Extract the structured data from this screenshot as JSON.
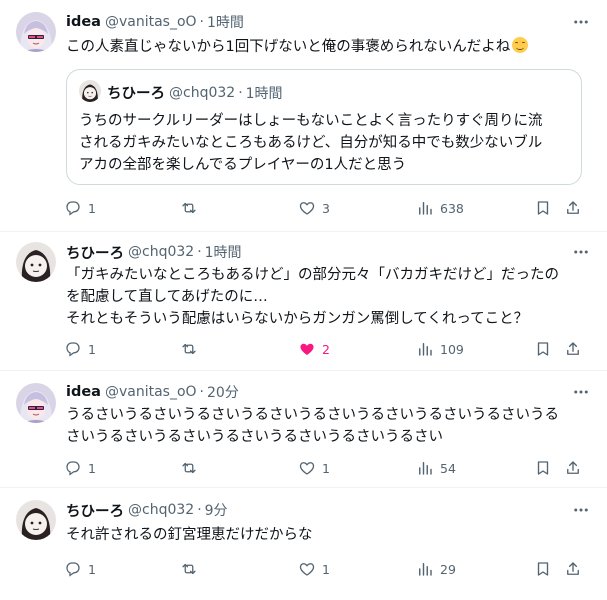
{
  "colors": {
    "text": "#0f1419",
    "muted": "#536471",
    "like_active": "#f91880",
    "border": "#cfd9de"
  },
  "tweets": [
    {
      "name": "idea",
      "handle": "@vanitas_oO",
      "sep": "·",
      "time": "1時間",
      "avatar": "anime-girl-avatar",
      "lines": [
        "この人素直じゃないから1回下げないと俺の事褒められないんだよね"
      ],
      "emoji": "smiling-face-emoji",
      "quote": {
        "name": "ちひーろ",
        "handle": "@chq032",
        "sep": "·",
        "time": "1時間",
        "avatar": "chihiro-avatar",
        "lines": [
          "うちのサークルリーダーはしょーもないことよく言ったりすぐ周りに流",
          "されるガキみたいなところもあるけど、自分が知る中でも数少ないブル",
          "アカの全部を楽しんでるプレイヤーの1人だと思う"
        ]
      },
      "actions": {
        "reply": "1",
        "retweet": "",
        "like": "3",
        "views": "638"
      }
    },
    {
      "name": "ちひーろ",
      "handle": "@chq032",
      "sep": "·",
      "time": "1時間",
      "avatar": "chihiro-avatar",
      "lines": [
        "「ガキみたいなところもあるけど」の部分元々「バカガキだけど」だったの",
        "を配慮して直してあげたのに…",
        "それともそういう配慮はいらないからガンガン罵倒してくれってこと？"
      ],
      "actions": {
        "reply": "1",
        "retweet": "",
        "like": "2",
        "views": "109"
      }
    },
    {
      "name": "idea",
      "handle": "@vanitas_oO",
      "sep": "·",
      "time": "20分",
      "avatar": "anime-girl-avatar",
      "lines": [
        "うるさいうるさいうるさいうるさいうるさいうるさいうるさいうるさいうる",
        "さいうるさいうるさいうるさいうるさいうるさいうるさい"
      ],
      "actions": {
        "reply": "1",
        "retweet": "",
        "like": "1",
        "views": "54"
      }
    },
    {
      "name": "ちひーろ",
      "handle": "@chq032",
      "sep": "·",
      "time": "9分",
      "avatar": "chihiro-avatar",
      "lines": [
        "それ許されるの釘宮理恵だけだからな"
      ],
      "actions": {
        "reply": "1",
        "retweet": "",
        "like": "1",
        "views": "29"
      }
    }
  ]
}
